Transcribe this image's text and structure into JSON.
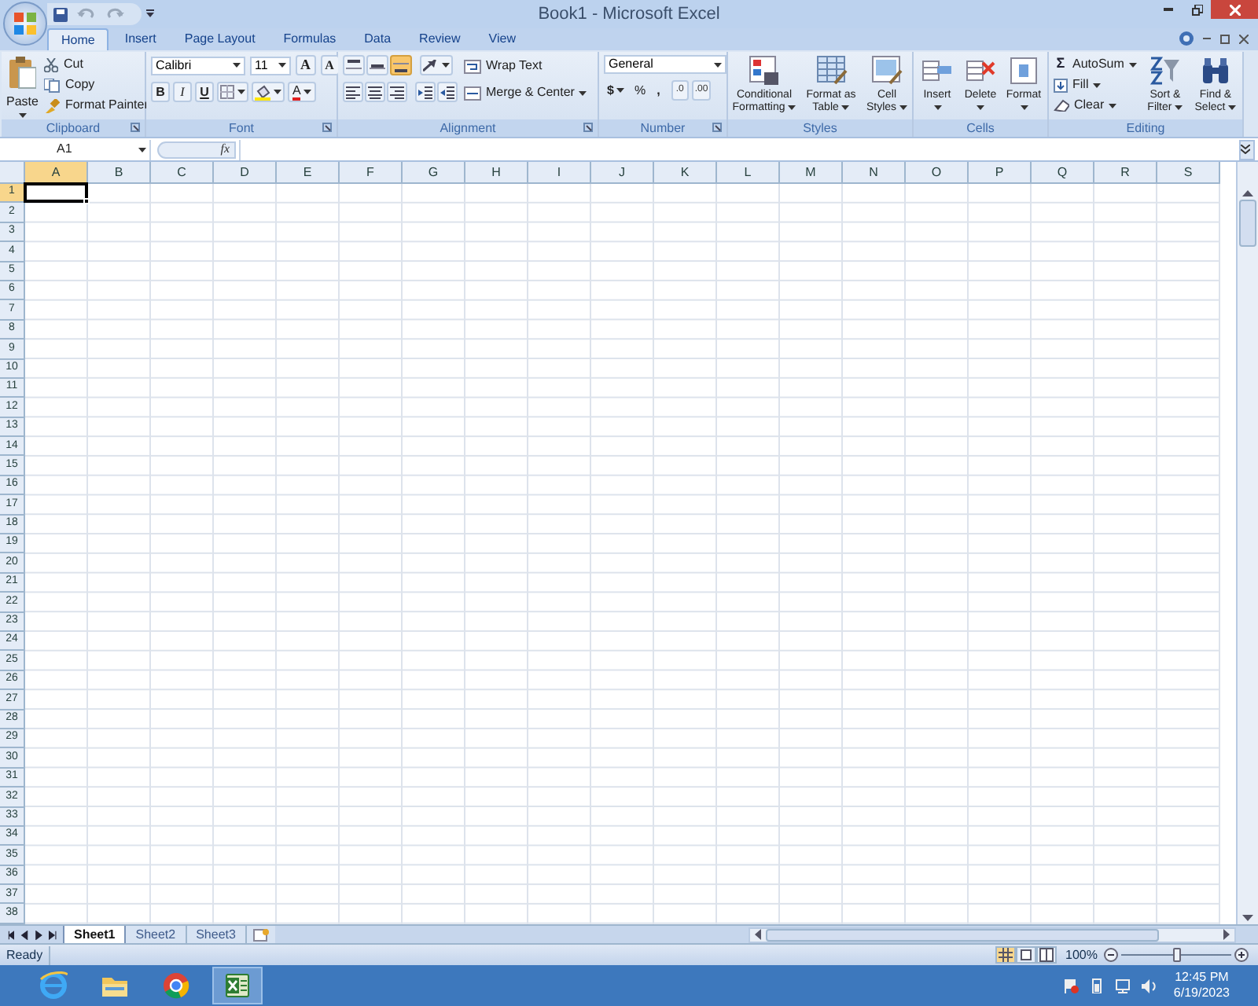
{
  "window": {
    "title": "Book1 - Microsoft Excel"
  },
  "tabs": [
    {
      "label": "Home",
      "selected": true
    },
    {
      "label": "Insert",
      "selected": false
    },
    {
      "label": "Page Layout",
      "selected": false
    },
    {
      "label": "Formulas",
      "selected": false
    },
    {
      "label": "Data",
      "selected": false
    },
    {
      "label": "Review",
      "selected": false
    },
    {
      "label": "View",
      "selected": false
    }
  ],
  "ribbon": {
    "groups": [
      {
        "kind": "clipboard",
        "label": "Clipboard",
        "launcher": true,
        "paste": "Paste",
        "commands": [
          "Cut",
          "Copy",
          "Format Painter"
        ]
      },
      {
        "kind": "font",
        "label": "Font",
        "launcher": true,
        "font": "Calibri",
        "size": "11",
        "grow": "A",
        "shrink": "A",
        "bold": "B",
        "italic": "I",
        "underline": "U",
        "font_color": "A"
      },
      {
        "kind": "alignment",
        "label": "Alignment",
        "launcher": true,
        "vertical_align": [
          {
            "selected": false
          },
          {
            "selected": false
          },
          {
            "selected": true
          }
        ],
        "wrap": "Wrap Text",
        "merge": "Merge & Center"
      },
      {
        "kind": "number",
        "label": "Number",
        "launcher": true,
        "format": "General",
        "currency": "$",
        "percent": "%",
        "comma": ",",
        "increase_decimal": ".0",
        "decrease_decimal": ".00"
      },
      {
        "kind": "styles",
        "label": "Styles",
        "launcher": false,
        "commands": [
          "Conditional Formatting",
          "Format as Table",
          "Cell Styles"
        ]
      },
      {
        "kind": "cells",
        "label": "Cells",
        "launcher": false,
        "commands": [
          "Insert",
          "Delete",
          "Format"
        ]
      },
      {
        "kind": "editing",
        "label": "Editing",
        "launcher": false,
        "autosum_symbol": "Σ",
        "small": [
          "AutoSum",
          "Fill",
          "Clear"
        ],
        "large": [
          "Sort & Filter",
          "Find & Select"
        ]
      }
    ]
  },
  "formula_bar": {
    "name_box": "A1",
    "function_label": "fx"
  },
  "columns": [
    {
      "label": "A",
      "selected": true
    },
    {
      "label": "B",
      "selected": false
    },
    {
      "label": "C",
      "selected": false
    },
    {
      "label": "D",
      "selected": false
    },
    {
      "label": "E",
      "selected": false
    },
    {
      "label": "F",
      "selected": false
    },
    {
      "label": "G",
      "selected": false
    },
    {
      "label": "H",
      "selected": false
    },
    {
      "label": "I",
      "selected": false
    },
    {
      "label": "J",
      "selected": false
    },
    {
      "label": "K",
      "selected": false
    },
    {
      "label": "L",
      "selected": false
    },
    {
      "label": "M",
      "selected": false
    },
    {
      "label": "N",
      "selected": false
    },
    {
      "label": "O",
      "selected": false
    },
    {
      "label": "P",
      "selected": false
    },
    {
      "label": "Q",
      "selected": false
    },
    {
      "label": "R",
      "selected": false
    },
    {
      "label": "S",
      "selected": false
    }
  ],
  "rows": [
    {
      "label": "1",
      "selected": true
    },
    {
      "label": "2",
      "selected": false
    },
    {
      "label": "3",
      "selected": false
    },
    {
      "label": "4",
      "selected": false
    },
    {
      "label": "5",
      "selected": false
    },
    {
      "label": "6",
      "selected": false
    },
    {
      "label": "7",
      "selected": false
    },
    {
      "label": "8",
      "selected": false
    },
    {
      "label": "9",
      "selected": false
    },
    {
      "label": "10",
      "selected": false
    },
    {
      "label": "11",
      "selected": false
    },
    {
      "label": "12",
      "selected": false
    },
    {
      "label": "13",
      "selected": false
    },
    {
      "label": "14",
      "selected": false
    },
    {
      "label": "15",
      "selected": false
    },
    {
      "label": "16",
      "selected": false
    },
    {
      "label": "17",
      "selected": false
    },
    {
      "label": "18",
      "selected": false
    },
    {
      "label": "19",
      "selected": false
    },
    {
      "label": "20",
      "selected": false
    },
    {
      "label": "21",
      "selected": false
    },
    {
      "label": "22",
      "selected": false
    },
    {
      "label": "23",
      "selected": false
    },
    {
      "label": "24",
      "selected": false
    },
    {
      "label": "25",
      "selected": false
    },
    {
      "label": "26",
      "selected": false
    },
    {
      "label": "27",
      "selected": false
    },
    {
      "label": "28",
      "selected": false
    },
    {
      "label": "29",
      "selected": false
    },
    {
      "label": "30",
      "selected": false
    },
    {
      "label": "31",
      "selected": false
    },
    {
      "label": "32",
      "selected": false
    },
    {
      "label": "33",
      "selected": false
    },
    {
      "label": "34",
      "selected": false
    },
    {
      "label": "35",
      "selected": false
    },
    {
      "label": "36",
      "selected": false
    },
    {
      "label": "37",
      "selected": false
    },
    {
      "label": "38",
      "selected": false
    }
  ],
  "sheet_tabs": [
    {
      "label": "Sheet1",
      "selected": true
    },
    {
      "label": "Sheet2",
      "selected": false
    },
    {
      "label": "Sheet3",
      "selected": false
    }
  ],
  "status_bar": {
    "status": "Ready",
    "views": [
      {
        "selected": true
      },
      {
        "selected": false
      },
      {
        "selected": false
      }
    ],
    "zoom": "100%",
    "zoom_level": {
      "level": 0.5
    }
  },
  "taskbar": {
    "apps": [
      {
        "selected": false
      },
      {
        "selected": false
      },
      {
        "selected": false
      },
      {
        "selected": true
      }
    ],
    "time": "12:45 PM",
    "date": "6/19/2023"
  }
}
